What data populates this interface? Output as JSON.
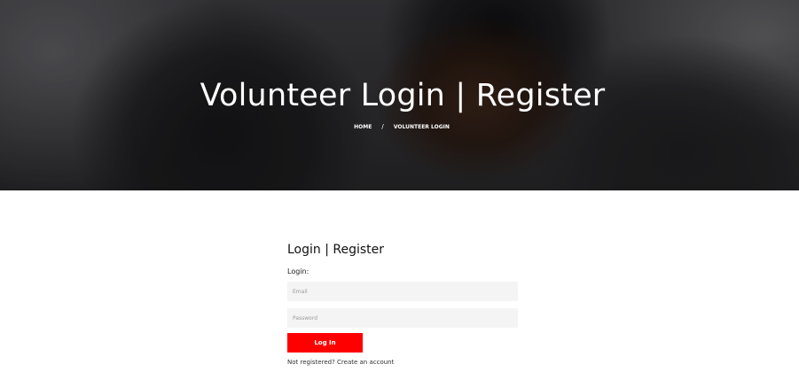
{
  "hero": {
    "title": "Volunteer Login | Register",
    "breadcrumb": {
      "home": "HOME",
      "separator": "/",
      "current": "VOLUNTEER LOGIN"
    }
  },
  "form": {
    "heading": "Login | Register",
    "login_label": "Login:",
    "email_placeholder": "Email",
    "password_placeholder": "Password",
    "login_button": "Log In",
    "not_registered_text": "Not registered?",
    "create_account_link": "Create an account"
  },
  "colors": {
    "accent": "#ff0000",
    "input_background": "#f4f4f4"
  }
}
